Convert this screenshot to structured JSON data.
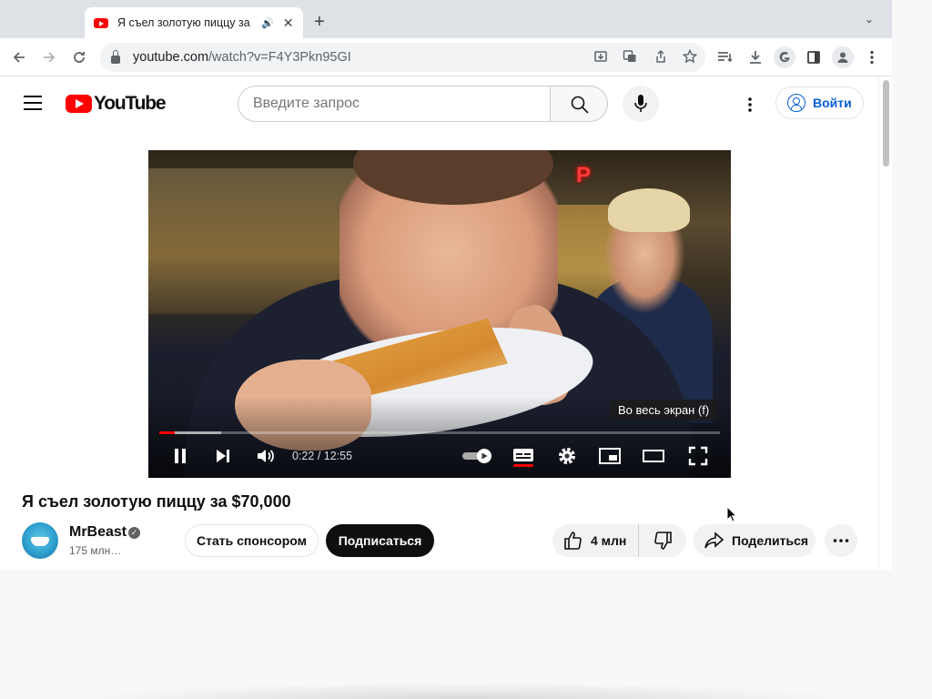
{
  "browser": {
    "tab_title": "Я съел золотую пиццу за",
    "url_host": "youtube.com",
    "url_path": "/watch?v=F4Y3Pkn95GI"
  },
  "youtube": {
    "logo_text": "YouTube",
    "search_placeholder": "Введите запрос",
    "signin_label": "Войти"
  },
  "player": {
    "scene_sign": "P",
    "tooltip": "Во весь экран (f)",
    "current_time": "0:22",
    "duration": "12:55",
    "progress_fraction": 0.028,
    "loaded_fraction": 0.11
  },
  "video": {
    "title": "Я съел золотую пиццу за $70,000",
    "channel_name": "MrBeast",
    "subscribers": "175 млн…",
    "sponsor_label": "Стать спонсором",
    "subscribe_label": "Подписаться",
    "likes": "4 млн",
    "share_label": "Поделиться"
  },
  "icons": {
    "favicon": "youtube-play-icon",
    "audio": "speaker-icon",
    "verified": "check-badge-icon"
  },
  "colors": {
    "brand_red": "#ff0000",
    "link_blue": "#065fd4",
    "subscribe_bg": "#0f0f0f"
  }
}
